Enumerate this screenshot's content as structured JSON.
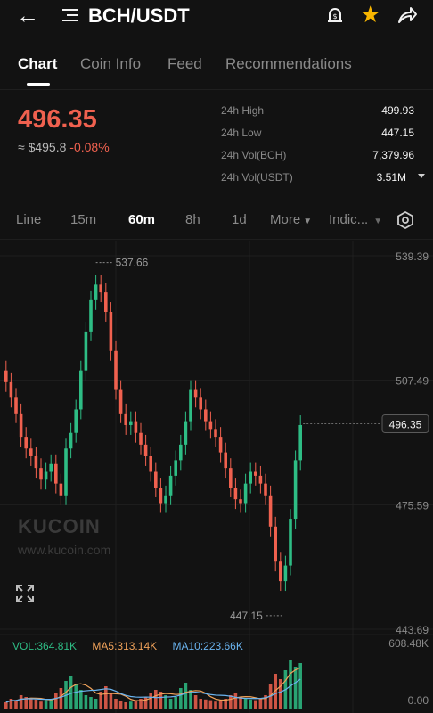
{
  "header": {
    "back_icon": "arrow-left-icon",
    "menu_icon": "menu-lines-icon",
    "pair": "BCH/USDT",
    "alert_icon": "price-alert-icon",
    "favorite_icon": "star-icon",
    "share_icon": "share-icon"
  },
  "tabs": [
    {
      "label": "Chart",
      "active": true
    },
    {
      "label": "Coin Info",
      "active": false
    },
    {
      "label": "Feed",
      "active": false
    },
    {
      "label": "Recommendations",
      "active": false
    }
  ],
  "ticker": {
    "last_price": "496.35",
    "approx_usd": "≈ $495.8",
    "change_pct": "-0.08%",
    "stats": [
      {
        "label": "24h High",
        "value": "499.93"
      },
      {
        "label": "24h Low",
        "value": "447.15"
      },
      {
        "label": "24h Vol(BCH)",
        "value": "7,379.96"
      },
      {
        "label": "24h Vol(USDT)",
        "value": "3.51M"
      }
    ]
  },
  "timeframes": [
    {
      "label": "Line",
      "active": false
    },
    {
      "label": "15m",
      "active": false
    },
    {
      "label": "60m",
      "active": true
    },
    {
      "label": "8h",
      "active": false
    },
    {
      "label": "1d",
      "active": false
    },
    {
      "label": "More",
      "active": false
    },
    {
      "label": "Indic...",
      "active": false
    }
  ],
  "settings_icon": "hexagon-settings-icon",
  "chart_data": {
    "type": "candlestick",
    "price_axis": [
      "539.39",
      "507.49",
      "475.59",
      "443.69"
    ],
    "current_price_label": "496.35",
    "high_marker": "537.66",
    "low_marker": "447.15",
    "volume_axis": [
      "608.48K",
      "0.00"
    ],
    "volume_legend": [
      {
        "text": "VOL:364.81K",
        "color": "#2ebd85"
      },
      {
        "text": "MA5:313.14K",
        "color": "#f0a25a"
      },
      {
        "text": "MA10:223.66K",
        "color": "#6ab4f0"
      }
    ],
    "ylim": [
      443.69,
      539.39
    ],
    "up_color": "#2ebd85",
    "down_color": "#f0614f",
    "closes": [
      507,
      503,
      499,
      493,
      490,
      488,
      485,
      482,
      484,
      486,
      481,
      478,
      490,
      494,
      500,
      510,
      520,
      528,
      532,
      530,
      525,
      515,
      505,
      499,
      496,
      497,
      494,
      491,
      488,
      484,
      480,
      476,
      478,
      483,
      487,
      491,
      497,
      505,
      503,
      500,
      497,
      495,
      493,
      489,
      485,
      480,
      477,
      476,
      481,
      484,
      483,
      481,
      478,
      470,
      461,
      456,
      460,
      472,
      487,
      496
    ],
    "volumes": [
      20,
      30,
      25,
      40,
      35,
      30,
      28,
      22,
      26,
      30,
      45,
      60,
      80,
      95,
      70,
      55,
      40,
      35,
      30,
      50,
      65,
      45,
      30,
      25,
      20,
      22,
      26,
      30,
      35,
      45,
      55,
      50,
      40,
      30,
      35,
      60,
      75,
      55,
      40,
      30,
      28,
      26,
      22,
      25,
      30,
      40,
      45,
      35,
      30,
      28,
      26,
      30,
      40,
      70,
      100,
      85,
      110,
      140,
      120,
      130
    ]
  },
  "watermark": {
    "brand": "KUCOIN",
    "url": "www.kucoin.com"
  },
  "expand_icon": "expand-icon"
}
